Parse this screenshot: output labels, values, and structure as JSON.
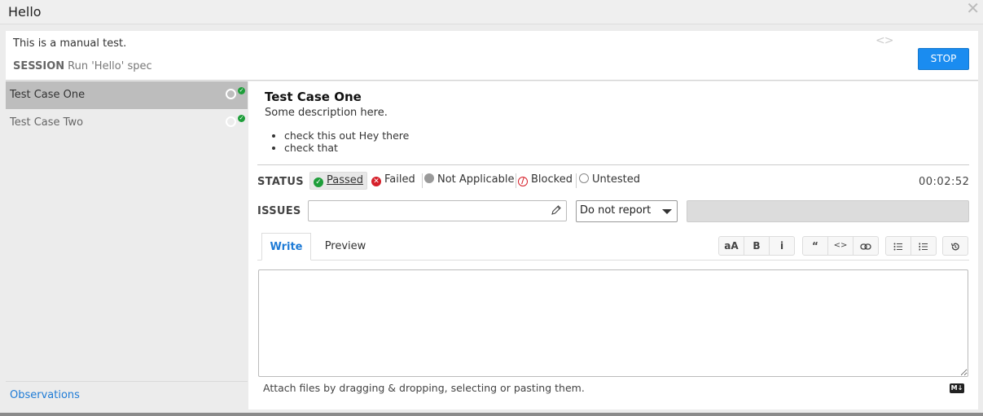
{
  "window": {
    "title": "Hello"
  },
  "session": {
    "description": "This is a manual test.",
    "session_label": "SESSION",
    "session_value": "Run 'Hello' spec",
    "stop_label": "STOP"
  },
  "sidebar": {
    "cases": [
      {
        "label": "Test Case One",
        "active": true
      },
      {
        "label": "Test Case Two",
        "active": false
      }
    ],
    "observations_label": "Observations"
  },
  "case": {
    "title": "Test Case One",
    "description": "Some description here.",
    "bullets": [
      "check this out Hey there",
      "check that"
    ]
  },
  "status": {
    "label": "STATUS",
    "options": [
      "Passed",
      "Failed",
      "Not Applicable",
      "Blocked",
      "Untested"
    ],
    "selected": "Passed",
    "timer": "00:02:52"
  },
  "issues": {
    "label": "ISSUES",
    "input_value": "",
    "select_value": "Do not report"
  },
  "editor": {
    "tabs": [
      "Write",
      "Preview"
    ],
    "active_tab": "Write",
    "toolbar": {
      "heading": "aA",
      "bold": "B",
      "italic": "i",
      "quote": "“",
      "code": "<>"
    },
    "text_value": "",
    "attach_hint": "Attach files by dragging & dropping, selecting or pasting them.",
    "markdown_badge": "M↓"
  },
  "colors": {
    "accent": "#1a8cf0",
    "link": "#1e7bd6",
    "passed": "#1e9e3a",
    "failed": "#d6202a",
    "blocked": "#d6202a",
    "not_applicable": "#9a9a9a"
  }
}
